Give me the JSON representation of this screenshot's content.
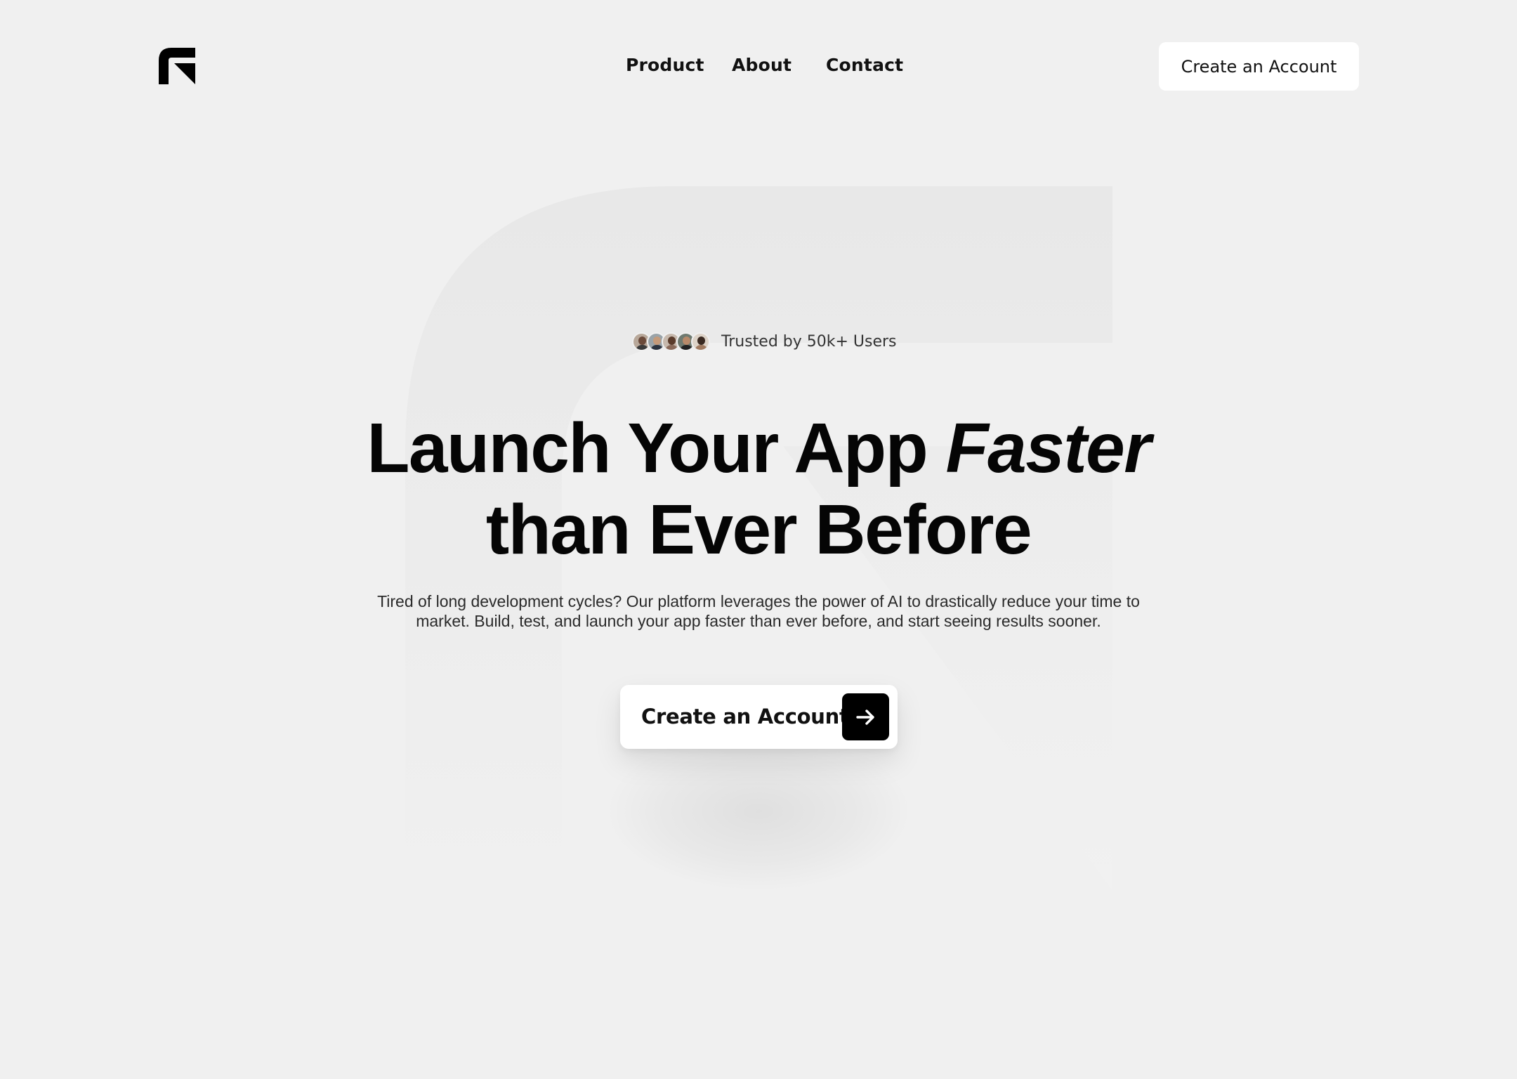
{
  "header": {
    "logo_name": "brand-logo",
    "nav": [
      {
        "label": "Product"
      },
      {
        "label": "About"
      },
      {
        "label": "Contact"
      }
    ],
    "cta_label": "Create an Account"
  },
  "hero": {
    "trusted_text": "Trusted by 50k+ Users",
    "avatar_count": 5,
    "headline_line1": "Launch Your App ",
    "headline_accent": "Faster",
    "headline_line2": "than Ever Before",
    "subtitle_line1": "Tired of long development cycles?  Our platform leverages the power of AI to drastically reduce your time to",
    "subtitle_line2": "market.  Build, test, and launch your app faster than ever before, and start seeing results sooner.",
    "cta_label": "Create an Account",
    "cta_icon": "arrow-right-icon"
  },
  "colors": {
    "background": "#f0f0f0",
    "text": "#0a0a0a",
    "button_bg": "#ffffff",
    "arrow_bg": "#000000"
  }
}
